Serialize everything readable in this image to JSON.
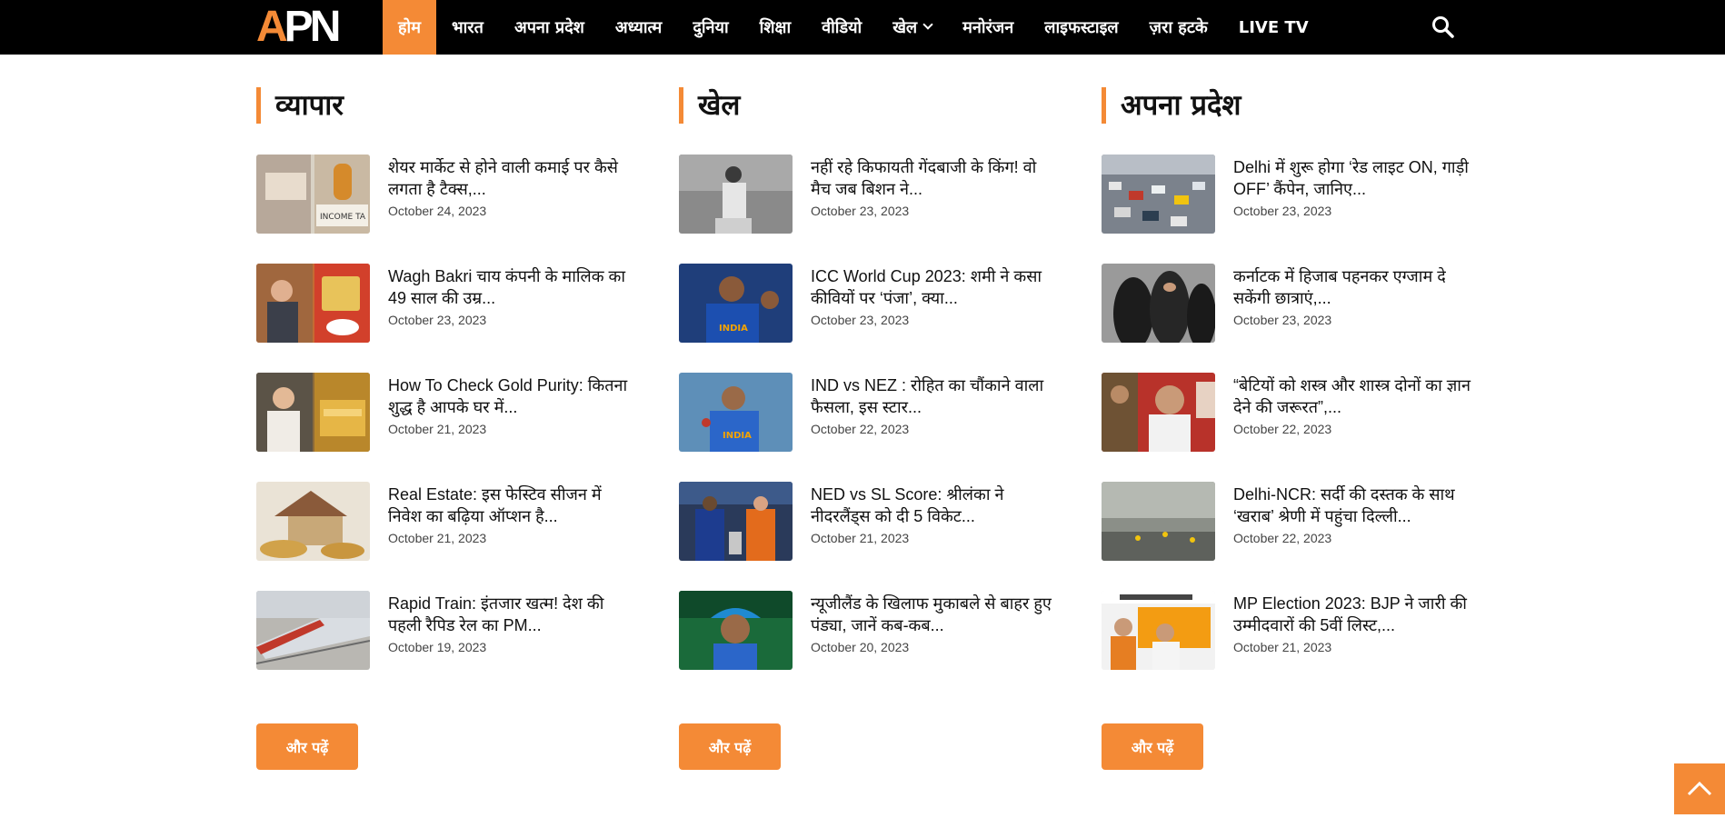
{
  "nav": {
    "logo_a": "A",
    "logo_pn": "PN",
    "items": [
      {
        "label": "होम",
        "active": true
      },
      {
        "label": "भारत"
      },
      {
        "label": "अपना प्रदेश"
      },
      {
        "label": "अध्यात्म"
      },
      {
        "label": "दुनिया"
      },
      {
        "label": "शिक्षा"
      },
      {
        "label": "वीडियो"
      },
      {
        "label": "खेल",
        "dropdown": true
      },
      {
        "label": "मनोरंजन"
      },
      {
        "label": "लाइफस्टाइल"
      },
      {
        "label": "ज़रा हटके"
      },
      {
        "label": "LIVE TV"
      }
    ],
    "search_icon": "search-icon"
  },
  "columns": [
    {
      "title": "व्यापार",
      "more_label": "और पढ़ें",
      "posts": [
        {
          "title": "शेयर मार्केट से होने वाली कमाई पर कैसे लगता है टैक्स,...",
          "date": "October 24, 2023"
        },
        {
          "title": "Wagh Bakri चाय कंपनी के मालिक का 49 साल की उम्र...",
          "date": "October 23, 2023"
        },
        {
          "title": "How To Check Gold Purity: कितना शुद्ध है आपके घर में...",
          "date": "October 21, 2023"
        },
        {
          "title": "Real Estate: इस फेस्टिव सीजन में निवेश का बढ़िया ऑप्शन है...",
          "date": "October 21, 2023"
        },
        {
          "title": "Rapid Train: इंतजार खत्म! देश की पहली रैपिड रेल का PM...",
          "date": "October 19, 2023"
        }
      ]
    },
    {
      "title": "खेल",
      "more_label": "और पढ़ें",
      "posts": [
        {
          "title": "नहीं रहे किफायती गेंदबाजी के किंग! वो मैच जब बिशन ने...",
          "date": "October 23, 2023"
        },
        {
          "title": "ICC World Cup 2023: शमी ने कसा कीवियों पर ‘पंजा’, क्या...",
          "date": "October 23, 2023"
        },
        {
          "title": "IND vs NEZ : रोहित का चौंकाने वाला फैसला, इस स्टार...",
          "date": "October 22, 2023"
        },
        {
          "title": "NED vs SL Score: श्रीलंका ने नीदरलैंड्स को दी 5 विकेट...",
          "date": "October 21, 2023"
        },
        {
          "title": "न्यूजीलैंड के खिलाफ मुकाबले से बाहर हुए पंड्या, जानें कब-कब...",
          "date": "October 20, 2023"
        }
      ]
    },
    {
      "title": "अपना प्रदेश",
      "more_label": "और पढ़ें",
      "posts": [
        {
          "title": "Delhi में शुरू होगा ‘रेड लाइट ON, गाड़ी OFF’ कैंपेन, जानिए...",
          "date": "October 23, 2023"
        },
        {
          "title": "कर्नाटक में हिजाब पहनकर एग्जाम दे सकेंगी छात्राएं,...",
          "date": "October 23, 2023"
        },
        {
          "title": "“बेटियों को शस्त्र और शास्त्र दोनों का ज्ञान देने की जरूरत”,...",
          "date": "October 22, 2023"
        },
        {
          "title": "Delhi-NCR: सर्दी की दस्तक के साथ ‘खराब’ श्रेणी में पहुंचा दिल्ली...",
          "date": "October 22, 2023"
        },
        {
          "title": "MP Election 2023: BJP ने जारी की उम्मीदवारों की 5वीं लिस्ट,...",
          "date": "October 21, 2023"
        }
      ]
    }
  ],
  "colors": {
    "accent": "#f48a36",
    "nav_bg": "#000000"
  },
  "scroll_top_icon": "arrow-up-icon"
}
